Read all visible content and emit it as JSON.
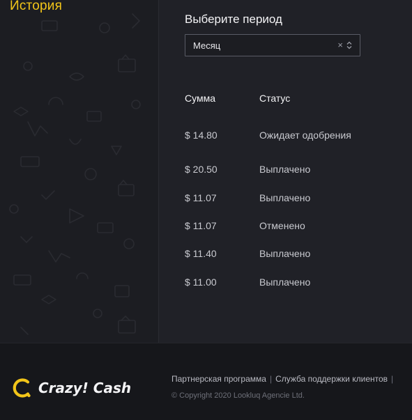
{
  "header": {
    "title": "История"
  },
  "filter": {
    "label": "Выберите период",
    "selected": "Месяц",
    "clear_symbol": "×"
  },
  "table": {
    "columns": [
      "Сумма",
      "Статус"
    ],
    "rows": [
      {
        "amount": "$ 14.80",
        "status": "Ожидает одобрения"
      },
      {
        "amount": "$ 20.50",
        "status": "Выплачено"
      },
      {
        "amount": "$ 11.07",
        "status": "Выплачено"
      },
      {
        "amount": "$ 11.07",
        "status": "Отменено"
      },
      {
        "amount": "$ 11.40",
        "status": "Выплачено"
      },
      {
        "amount": "$ 11.00",
        "status": "Выплачено"
      }
    ]
  },
  "footer": {
    "brand": "Crazy! Cash",
    "links": [
      "Партнерская программа",
      "Служба поддержки клиентов"
    ],
    "separator": "|",
    "copyright": "© Copyright 2020 Lookluq Agencie Ltd."
  },
  "colors": {
    "accent": "#f2c519",
    "background": "#202127",
    "panel": "#1c1d22",
    "footer": "#16171b"
  }
}
